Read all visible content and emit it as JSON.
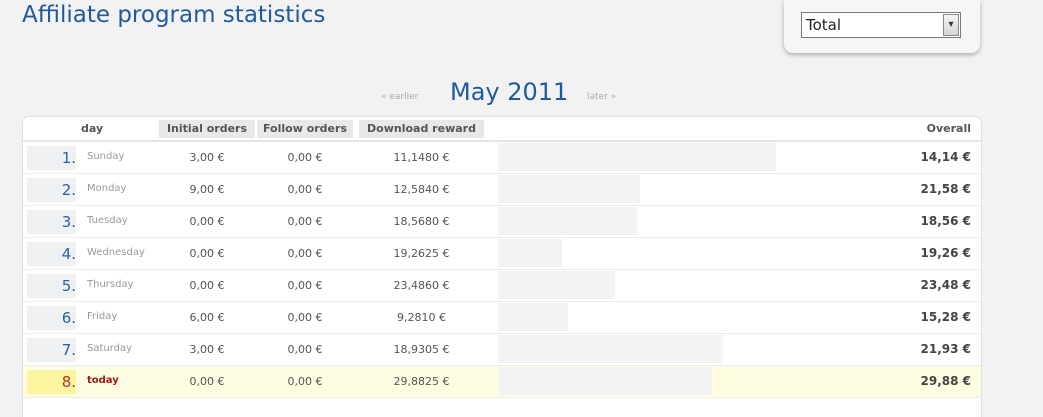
{
  "page": {
    "title": "Affiliate program statistics"
  },
  "filter": {
    "selected": "Total",
    "arrow": "▾"
  },
  "nav": {
    "earlier": "« earlier",
    "month": "May 2011",
    "later": "later »"
  },
  "table": {
    "headers": {
      "day": "day",
      "initial_orders": "Initial orders",
      "follow_orders": "Follow orders",
      "download_reward": "Download reward",
      "overall": "Overall"
    },
    "rows": [
      {
        "num": "1.",
        "day": "Sunday",
        "initial": "3,00 €",
        "follow": "0,00 €",
        "download": "11,1480 €",
        "overall": "14,14 €",
        "share": 1.0
      },
      {
        "num": "2.",
        "day": "Monday",
        "initial": "9,00 €",
        "follow": "0,00 €",
        "download": "12,5840 €",
        "overall": "21,58 €",
        "share": 0.51
      },
      {
        "num": "3.",
        "day": "Tuesday",
        "initial": "0,00 €",
        "follow": "0,00 €",
        "download": "18,5680 €",
        "overall": "18,56 €",
        "share": 0.5
      },
      {
        "num": "4.",
        "day": "Wednesday",
        "initial": "0,00 €",
        "follow": "0,00 €",
        "download": "19,2625 €",
        "overall": "19,26 €",
        "share": 0.23
      },
      {
        "num": "5.",
        "day": "Thursday",
        "initial": "0,00 €",
        "follow": "0,00 €",
        "download": "23,4860 €",
        "overall": "23,48 €",
        "share": 0.42
      },
      {
        "num": "6.",
        "day": "Friday",
        "initial": "6,00 €",
        "follow": "0,00 €",
        "download": "9,2810 €",
        "overall": "15,28 €",
        "share": 0.25
      },
      {
        "num": "7.",
        "day": "Saturday",
        "initial": "3,00 €",
        "follow": "0,00 €",
        "download": "18,9305 €",
        "overall": "21,93 €",
        "share": 0.81
      },
      {
        "num": "8.",
        "day": "today",
        "initial": "0,00 €",
        "follow": "0,00 €",
        "download": "29,8825 €",
        "overall": "29,88 €",
        "share": 0.77,
        "is_today": true
      }
    ]
  }
}
